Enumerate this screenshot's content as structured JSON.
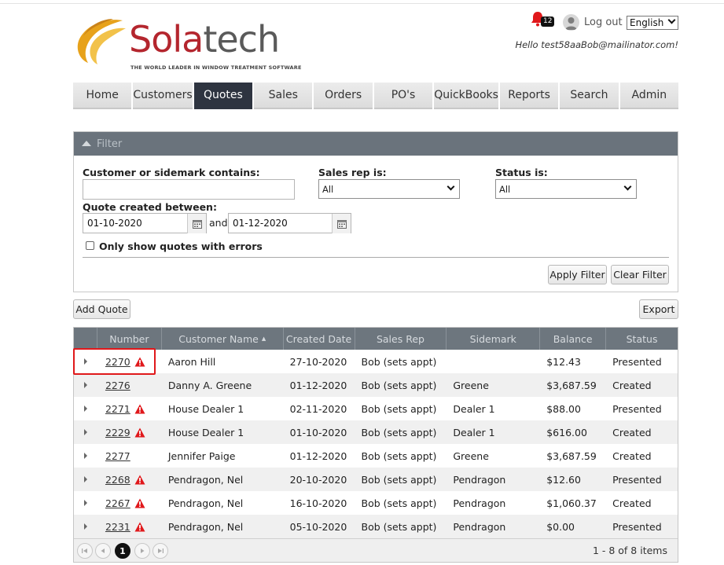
{
  "brand": {
    "name_part1": "Sola",
    "name_part2": "tech",
    "tagline": "THE WORLD LEADER IN WINDOW TREATMENT SOFTWARE"
  },
  "header": {
    "notifications_count": "12",
    "logout_label": "Log out",
    "language": "English",
    "greeting": "Hello test58aaBob@mailinator.com!"
  },
  "nav": [
    "Home",
    "Customers",
    "Quotes",
    "Sales",
    "Orders",
    "PO's",
    "QuickBooks",
    "Reports",
    "Search",
    "Admin"
  ],
  "filter": {
    "title": "Filter",
    "customer_label": "Customer or sidemark contains:",
    "customer_value": "",
    "salesrep_label": "Sales rep is:",
    "salesrep_value": "All",
    "status_label": "Status is:",
    "status_value": "All",
    "created_label": "Quote created between:",
    "date_from": "01-10-2020",
    "and_label": "and",
    "date_to": "01-12-2020",
    "errors_only_label": "Only show quotes with errors",
    "apply_label": "Apply Filter",
    "clear_label": "Clear Filter"
  },
  "actions": {
    "add_quote": "Add Quote",
    "export": "Export"
  },
  "grid": {
    "columns": [
      "Number",
      "Customer Name",
      "Created Date",
      "Sales Rep",
      "Sidemark",
      "Balance",
      "Status"
    ],
    "sort_indicator": "▲",
    "rows": [
      {
        "number": "2270",
        "error": true,
        "customer": "Aaron Hill",
        "created": "27-10-2020",
        "rep": "Bob (sets appt)",
        "sidemark": "",
        "balance": "$12.43",
        "status": "Presented"
      },
      {
        "number": "2276",
        "error": false,
        "customer": "Danny A. Greene",
        "created": "01-12-2020",
        "rep": "Bob (sets appt)",
        "sidemark": "Greene",
        "balance": "$3,687.59",
        "status": "Created"
      },
      {
        "number": "2271",
        "error": true,
        "customer": "House Dealer 1",
        "created": "02-11-2020",
        "rep": "Bob (sets appt)",
        "sidemark": "Dealer 1",
        "balance": "$88.00",
        "status": "Presented"
      },
      {
        "number": "2229",
        "error": true,
        "customer": "House Dealer 1",
        "created": "01-10-2020",
        "rep": "Bob (sets appt)",
        "sidemark": "Dealer 1",
        "balance": "$616.00",
        "status": "Created"
      },
      {
        "number": "2277",
        "error": false,
        "customer": "Jennifer Paige",
        "created": "01-12-2020",
        "rep": "Bob (sets appt)",
        "sidemark": "Greene",
        "balance": "$3,687.59",
        "status": "Created"
      },
      {
        "number": "2268",
        "error": true,
        "customer": "Pendragon, Nel",
        "created": "20-10-2020",
        "rep": "Bob (sets appt)",
        "sidemark": "Pendragon",
        "balance": "$12.60",
        "status": "Presented"
      },
      {
        "number": "2267",
        "error": true,
        "customer": "Pendragon, Nel",
        "created": "16-10-2020",
        "rep": "Bob (sets appt)",
        "sidemark": "Pendragon",
        "balance": "$1,060.37",
        "status": "Created"
      },
      {
        "number": "2231",
        "error": true,
        "customer": "Pendragon, Nel",
        "created": "05-10-2020",
        "rep": "Bob (sets appt)",
        "sidemark": "Pendragon",
        "balance": "$0.00",
        "status": "Presented"
      }
    ]
  },
  "pager": {
    "current_page": "1",
    "info": "1 - 8 of 8 items"
  },
  "colors": {
    "brand_red": "#b4262e",
    "brand_gold": "#e7a21b",
    "nav_active": "#2e3440",
    "header_gray": "#6d767e",
    "warning_red": "#e0181b"
  }
}
